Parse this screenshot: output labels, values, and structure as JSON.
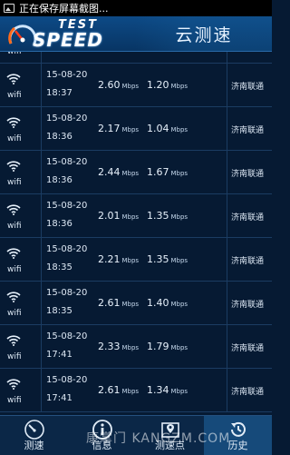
{
  "status_bar": {
    "text": "正在保存屏幕截图..."
  },
  "header": {
    "logo_test": "TEST",
    "logo_speed": "SPEED",
    "title": "云测速"
  },
  "rows": [
    {
      "net": "wifi",
      "date": "",
      "time": "18:37",
      "down": "",
      "up": "",
      "isp": ""
    },
    {
      "net": "wifi",
      "date": "15-08-20",
      "time": "18:37",
      "down": "2.60",
      "up": "1.20",
      "isp": "济南联通"
    },
    {
      "net": "wifi",
      "date": "15-08-20",
      "time": "18:36",
      "down": "2.17",
      "up": "1.04",
      "isp": "济南联通"
    },
    {
      "net": "wifi",
      "date": "15-08-20",
      "time": "18:36",
      "down": "2.44",
      "up": "1.67",
      "isp": "济南联通"
    },
    {
      "net": "wifi",
      "date": "15-08-20",
      "time": "18:36",
      "down": "2.01",
      "up": "1.35",
      "isp": "济南联通"
    },
    {
      "net": "wifi",
      "date": "15-08-20",
      "time": "18:35",
      "down": "2.21",
      "up": "1.35",
      "isp": "济南联通"
    },
    {
      "net": "wifi",
      "date": "15-08-20",
      "time": "18:35",
      "down": "2.61",
      "up": "1.40",
      "isp": "济南联通"
    },
    {
      "net": "wifi",
      "date": "15-08-20",
      "time": "17:41",
      "down": "2.33",
      "up": "1.79",
      "isp": "济南联通"
    },
    {
      "net": "wifi",
      "date": "15-08-20",
      "time": "17:41",
      "down": "2.61",
      "up": "1.34",
      "isp": "济南联通"
    }
  ],
  "unit": "Mbps",
  "tabs": [
    {
      "label": "测速",
      "icon": "gauge-icon"
    },
    {
      "label": "信息",
      "icon": "info-icon"
    },
    {
      "label": "测速点",
      "icon": "map-icon"
    },
    {
      "label": "历史",
      "icon": "history-icon",
      "active": true
    }
  ],
  "watermark": "康掌门 KANGZM.COM",
  "colors": {
    "background": "#061a33",
    "header": "#0d4a86",
    "active_tab": "#164a7a"
  }
}
